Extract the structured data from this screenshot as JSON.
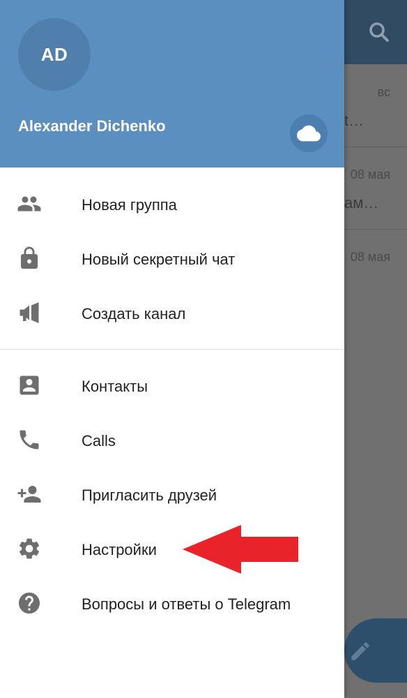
{
  "background_app": {
    "rows": [
      {
        "time": "вс",
        "snippet": "t…"
      },
      {
        "time": "08 мая",
        "snippet": "ам…"
      },
      {
        "time": "08 мая",
        "snippet": ""
      }
    ],
    "search_icon": "search-icon",
    "compose_icon": "pencil-icon"
  },
  "drawer": {
    "avatar_initials": "AD",
    "user_name": "Alexander Dichenko",
    "cloud_icon": "cloud-icon",
    "colors": {
      "header": "#5b8fbf",
      "avatar": "#4f7fad",
      "icon": "#6e6e6e",
      "arrow": "#e8232a"
    },
    "menu_group1": [
      {
        "label": "Новая группа",
        "icon": "group-icon"
      },
      {
        "label": "Новый секретный чат",
        "icon": "lock-icon"
      },
      {
        "label": "Создать канал",
        "icon": "megaphone-icon"
      }
    ],
    "menu_group2": [
      {
        "label": "Контакты",
        "icon": "contact-icon"
      },
      {
        "label": "Calls",
        "icon": "phone-icon"
      },
      {
        "label": "Пригласить друзей",
        "icon": "add-person-icon"
      },
      {
        "label": "Настройки",
        "icon": "gear-icon"
      },
      {
        "label": "Вопросы и ответы о Telegram",
        "icon": "help-icon"
      }
    ]
  }
}
